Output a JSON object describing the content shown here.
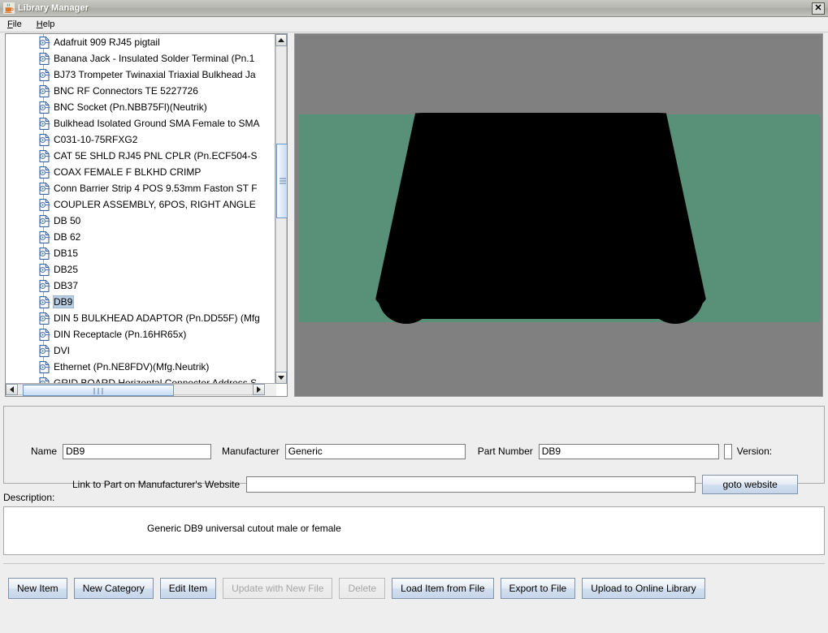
{
  "window": {
    "title": "Library Manager",
    "icon": "java-coffee-cup-icon",
    "close_label": "✕"
  },
  "menubar": {
    "items": [
      {
        "label": "File",
        "mnemonic": "F"
      },
      {
        "label": "Help",
        "mnemonic": "H"
      }
    ]
  },
  "tree": {
    "selected": "DB9",
    "items": [
      {
        "label": "Adafruit 909 RJ45 pigtail",
        "selected": false
      },
      {
        "label": "Banana Jack - Insulated Solder Terminal (Pn.1",
        "selected": false
      },
      {
        "label": "BJ73 Trompeter Twinaxial Triaxial Bulkhead Ja",
        "selected": false
      },
      {
        "label": "BNC RF Connectors TE 5227726",
        "selected": false
      },
      {
        "label": "BNC Socket (Pn.NBB75Fl)(Neutrik)",
        "selected": false
      },
      {
        "label": "Bulkhead Isolated Ground SMA Female to SMA",
        "selected": false
      },
      {
        "label": "C031-10-75RFXG2",
        "selected": false
      },
      {
        "label": "CAT 5E SHLD RJ45 PNL CPLR (Pn.ECF504-S",
        "selected": false
      },
      {
        "label": "COAX FEMALE F BLKHD CRIMP",
        "selected": false
      },
      {
        "label": "Conn Barrier Strip 4 POS 9.53mm Faston ST F",
        "selected": false
      },
      {
        "label": "COUPLER ASSEMBLY, 6POS, RIGHT ANGLE",
        "selected": false
      },
      {
        "label": "DB 50",
        "selected": false
      },
      {
        "label": "DB 62",
        "selected": false
      },
      {
        "label": "DB15",
        "selected": false
      },
      {
        "label": "DB25",
        "selected": false
      },
      {
        "label": "DB37",
        "selected": false
      },
      {
        "label": "DB9",
        "selected": true
      },
      {
        "label": "DIN 5 BULKHEAD ADAPTOR (Pn.DD55F) (Mfg",
        "selected": false
      },
      {
        "label": "DIN Receptacle (Pn.16HR65x)",
        "selected": false
      },
      {
        "label": "DVI",
        "selected": false
      },
      {
        "label": "Ethernet (Pn.NE8FDV)(Mfg.Neutrik)",
        "selected": false
      },
      {
        "label": "GRID BOARD Horizontal Connector Address S",
        "selected": false
      }
    ]
  },
  "preview": {
    "alt": "DB9 connector cutout preview",
    "background_color": "#808080",
    "panel_color": "#589078",
    "cutout_color": "#000000"
  },
  "form": {
    "name_label": "Name",
    "name_value": "DB9",
    "manufacturer_label": "Manufacturer",
    "manufacturer_value": "Generic",
    "part_number_label": "Part Number",
    "part_number_value": "DB9",
    "version_label": "Version:",
    "version_value": "",
    "link_label": "Link to Part on Manufacturer's Website",
    "link_value": "",
    "link_placeholder": "",
    "goto_website_label": "goto website",
    "description_label": "Description:",
    "description_text": "Generic DB9 universal cutout male or female"
  },
  "actions": {
    "buttons": [
      {
        "label": "New Item",
        "enabled": true
      },
      {
        "label": "New Category",
        "enabled": true
      },
      {
        "label": "Edit Item",
        "enabled": true
      },
      {
        "label": "Update with New File",
        "enabled": false
      },
      {
        "label": "Delete",
        "enabled": false
      },
      {
        "label": "Load Item from File",
        "enabled": true
      },
      {
        "label": "Export to File",
        "enabled": true
      },
      {
        "label": "Upload to Online Library",
        "enabled": true
      }
    ]
  },
  "scrollbars": {
    "vertical_thumb_label": "vertical-scroll-thumb",
    "horizontal_thumb_label": "horizontal-scroll-thumb"
  }
}
